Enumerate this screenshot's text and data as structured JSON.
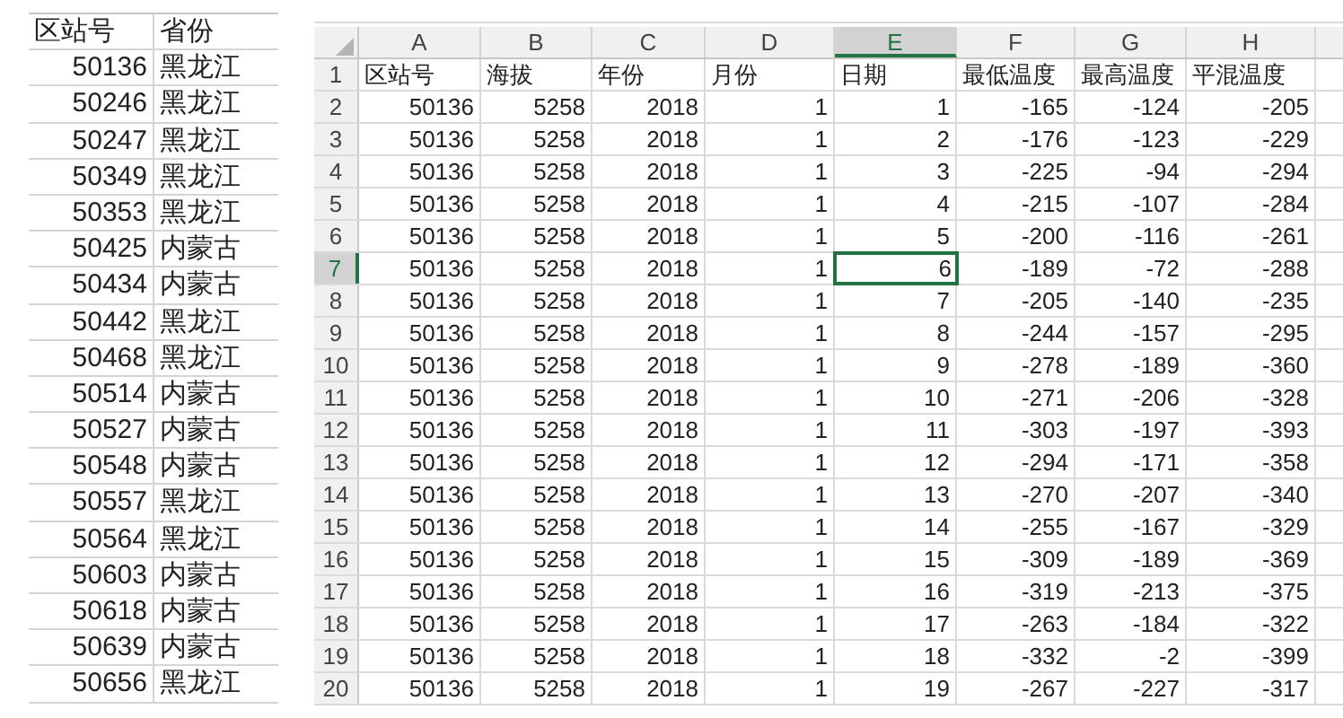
{
  "station_table": {
    "columns": [
      "区站号",
      "省份"
    ],
    "rows": [
      [
        "50136",
        "黑龙江"
      ],
      [
        "50246",
        "黑龙江"
      ],
      [
        "50247",
        "黑龙江"
      ],
      [
        "50349",
        "黑龙江"
      ],
      [
        "50353",
        "黑龙江"
      ],
      [
        "50425",
        "内蒙古"
      ],
      [
        "50434",
        "内蒙古"
      ],
      [
        "50442",
        "黑龙江"
      ],
      [
        "50468",
        "黑龙江"
      ],
      [
        "50514",
        "内蒙古"
      ],
      [
        "50527",
        "内蒙古"
      ],
      [
        "50548",
        "内蒙古"
      ],
      [
        "50557",
        "黑龙江"
      ],
      [
        "50564",
        "黑龙江"
      ],
      [
        "50603",
        "内蒙古"
      ],
      [
        "50618",
        "内蒙古"
      ],
      [
        "50639",
        "内蒙古"
      ],
      [
        "50656",
        "黑龙江"
      ]
    ]
  },
  "spreadsheet": {
    "column_headers": [
      {
        "label": "A",
        "selected": false
      },
      {
        "label": "B",
        "selected": false
      },
      {
        "label": "C",
        "selected": false
      },
      {
        "label": "D",
        "selected": false
      },
      {
        "label": "E",
        "selected": true
      },
      {
        "label": "F",
        "selected": false
      },
      {
        "label": "G",
        "selected": false
      },
      {
        "label": "H",
        "selected": false
      }
    ],
    "rows": [
      {
        "header": "1",
        "selected": false,
        "cells": [
          "区站号",
          "海拔",
          "年份",
          "月份",
          "日期",
          "最低温度",
          "最高温度",
          "平混温度"
        ]
      },
      {
        "header": "2",
        "selected": false,
        "cells": [
          "50136",
          "5258",
          "2018",
          "1",
          "1",
          "-165",
          "-124",
          "-205"
        ]
      },
      {
        "header": "3",
        "selected": false,
        "cells": [
          "50136",
          "5258",
          "2018",
          "1",
          "2",
          "-176",
          "-123",
          "-229"
        ]
      },
      {
        "header": "4",
        "selected": false,
        "cells": [
          "50136",
          "5258",
          "2018",
          "1",
          "3",
          "-225",
          "-94",
          "-294"
        ]
      },
      {
        "header": "5",
        "selected": false,
        "cells": [
          "50136",
          "5258",
          "2018",
          "1",
          "4",
          "-215",
          "-107",
          "-284"
        ]
      },
      {
        "header": "6",
        "selected": false,
        "cells": [
          "50136",
          "5258",
          "2018",
          "1",
          "5",
          "-200",
          "-116",
          "-261"
        ]
      },
      {
        "header": "7",
        "selected": true,
        "cells": [
          "50136",
          "5258",
          "2018",
          "1",
          "6",
          "-189",
          "-72",
          "-288"
        ]
      },
      {
        "header": "8",
        "selected": false,
        "cells": [
          "50136",
          "5258",
          "2018",
          "1",
          "7",
          "-205",
          "-140",
          "-235"
        ]
      },
      {
        "header": "9",
        "selected": false,
        "cells": [
          "50136",
          "5258",
          "2018",
          "1",
          "8",
          "-244",
          "-157",
          "-295"
        ]
      },
      {
        "header": "10",
        "selected": false,
        "cells": [
          "50136",
          "5258",
          "2018",
          "1",
          "9",
          "-278",
          "-189",
          "-360"
        ]
      },
      {
        "header": "11",
        "selected": false,
        "cells": [
          "50136",
          "5258",
          "2018",
          "1",
          "10",
          "-271",
          "-206",
          "-328"
        ]
      },
      {
        "header": "12",
        "selected": false,
        "cells": [
          "50136",
          "5258",
          "2018",
          "1",
          "11",
          "-303",
          "-197",
          "-393"
        ]
      },
      {
        "header": "13",
        "selected": false,
        "cells": [
          "50136",
          "5258",
          "2018",
          "1",
          "12",
          "-294",
          "-171",
          "-358"
        ]
      },
      {
        "header": "14",
        "selected": false,
        "cells": [
          "50136",
          "5258",
          "2018",
          "1",
          "13",
          "-270",
          "-207",
          "-340"
        ]
      },
      {
        "header": "15",
        "selected": false,
        "cells": [
          "50136",
          "5258",
          "2018",
          "1",
          "14",
          "-255",
          "-167",
          "-329"
        ]
      },
      {
        "header": "16",
        "selected": false,
        "cells": [
          "50136",
          "5258",
          "2018",
          "1",
          "15",
          "-309",
          "-189",
          "-369"
        ]
      },
      {
        "header": "17",
        "selected": false,
        "cells": [
          "50136",
          "5258",
          "2018",
          "1",
          "16",
          "-319",
          "-213",
          "-375"
        ]
      },
      {
        "header": "18",
        "selected": false,
        "cells": [
          "50136",
          "5258",
          "2018",
          "1",
          "17",
          "-263",
          "-184",
          "-322"
        ]
      },
      {
        "header": "19",
        "selected": false,
        "cells": [
          "50136",
          "5258",
          "2018",
          "1",
          "18",
          "-332",
          "-2",
          "-399"
        ]
      },
      {
        "header": "20",
        "selected": false,
        "cells": [
          "50136",
          "5258",
          "2018",
          "1",
          "19",
          "-267",
          "-227",
          "-317"
        ]
      }
    ]
  }
}
